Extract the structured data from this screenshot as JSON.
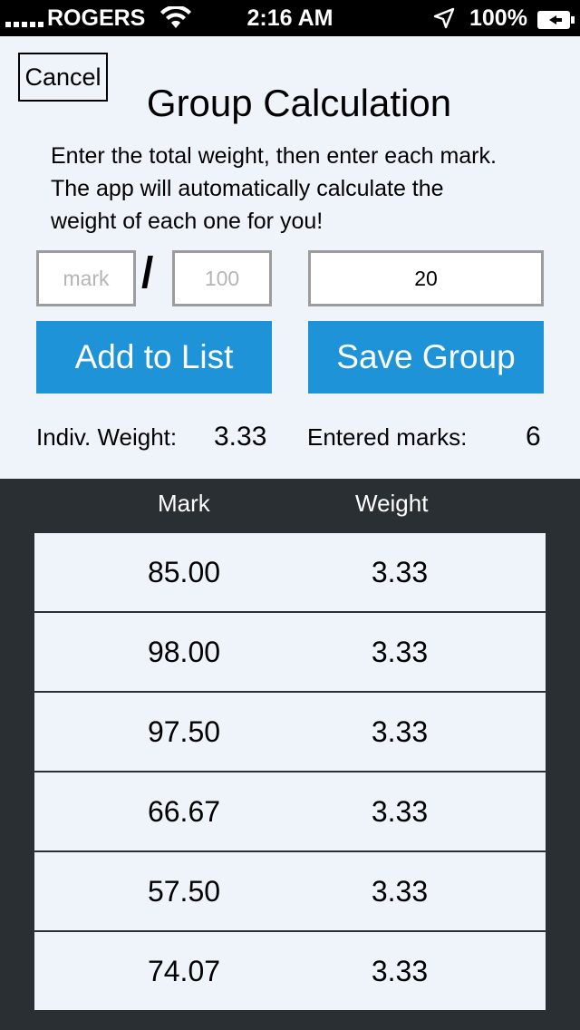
{
  "status_bar": {
    "carrier": "ROGERS",
    "time": "2:16 AM",
    "battery": "100%"
  },
  "header": {
    "cancel_label": "Cancel",
    "title": "Group Calculation"
  },
  "instructions": {
    "line1": "Enter the total weight, then enter each mark.",
    "line2": "The app will automatically calculate the",
    "line3": "weight of each one for you!"
  },
  "inputs": {
    "mark_placeholder": "mark",
    "separator": "/",
    "total_placeholder": "100",
    "weight_value": "20"
  },
  "buttons": {
    "add": "Add to List",
    "save": "Save Group"
  },
  "stats": {
    "indiv_label": "Indiv. Weight:",
    "indiv_value": "3.33",
    "entered_label": "Entered marks:",
    "entered_value": "6"
  },
  "table": {
    "headers": {
      "mark": "Mark",
      "weight": "Weight"
    },
    "rows": [
      {
        "mark": "85.00",
        "weight": "3.33"
      },
      {
        "mark": "98.00",
        "weight": "3.33"
      },
      {
        "mark": "97.50",
        "weight": "3.33"
      },
      {
        "mark": "66.67",
        "weight": "3.33"
      },
      {
        "mark": "57.50",
        "weight": "3.33"
      },
      {
        "mark": "74.07",
        "weight": "3.33"
      }
    ]
  },
  "icons": [
    "signal-icon",
    "wifi-icon",
    "location-icon",
    "battery-icon"
  ],
  "colors": {
    "accent": "#1f93d8",
    "panel": "#eff4fb",
    "dark_bg": "#2a2f33"
  }
}
